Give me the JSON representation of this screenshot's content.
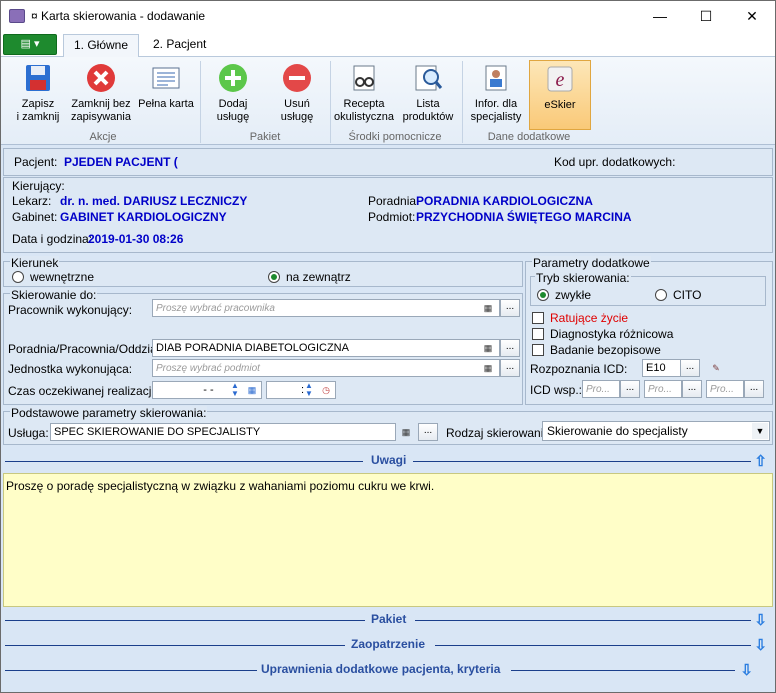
{
  "window": {
    "title": "¤ Karta skierowania - dodawanie",
    "minimize": "—",
    "maximize": "☐",
    "close": "✕"
  },
  "tabs": [
    {
      "label": "1. Główne"
    },
    {
      "label": "2. Pacjent"
    }
  ],
  "ribbon": {
    "save_label_1": "Zapisz",
    "save_label_2": "i zamknij",
    "close_label_1": "Zamknij bez",
    "close_label_2": "zapisywania",
    "fullcard_label": "Pełna karta",
    "group_akcje": "Akcje",
    "add_label_1": "Dodaj",
    "add_label_2": "usługę",
    "remove_label_1": "Usuń",
    "remove_label_2": "usługę",
    "group_pakiet": "Pakiet",
    "recepta_label_1": "Recepta",
    "recepta_label_2": "okulistyczna",
    "produkty_label_1": "Lista",
    "produkty_label_2": "produktów",
    "group_srodki": "Środki pomocnicze",
    "infor_label_1": "Infor. dla",
    "infor_label_2": "specjalisty",
    "eskier_label": "eSkier",
    "group_dane": "Dane dodatkowe"
  },
  "patient": {
    "label": "Pacjent:",
    "value": "PJEDEN PACJENT (",
    "kod_label": "Kod upr. dodatkowych:"
  },
  "kierujacy": {
    "legend": "Kierujący:",
    "lekarz_label": "Lekarz:",
    "lekarz_value": "dr. n. med. DARIUSZ LECZNICZY",
    "gabinet_label": "Gabinet:",
    "gabinet_value": "GABINET KARDIOLOGICZNY",
    "poradnia_label": "Poradnia:",
    "poradnia_value": "PORADNIA KARDIOLOGICZNA",
    "podmiot_label": "Podmiot:",
    "podmiot_value": "PRZYCHODNIA ŚWIĘTEGO MARCINA",
    "data_label": "Data i godzina:",
    "data_value": "2019-01-30 08:26"
  },
  "kierunek": {
    "legend": "Kierunek",
    "opt1": "wewnętrzne",
    "opt2": "na zewnątrz",
    "selected": "na zewnątrz"
  },
  "skierowanie_do": {
    "legend": "Skierowanie do:",
    "pracownik_label": "Pracownik wykonujący:",
    "pracownik_placeholder": "Proszę wybrać pracownika",
    "poradnia_label": "Poradnia/Pracownia/Oddział:",
    "poradnia_value": "DIAB PORADNIA DIABETOLOGICZNA",
    "jednostka_label": "Jednostka wykonująca:",
    "jednostka_placeholder": "Proszę wybrać podmiot",
    "czas_label": "Czas oczekiwanej realizacji:",
    "date_value": "-   -",
    "time_value": ":"
  },
  "parametry": {
    "legend": "Parametry dodatkowe",
    "tryb_legend": "Tryb skierowania:",
    "zwykle": "zwykłe",
    "cito": "CITO",
    "ratujace": "Ratujące życie",
    "diagnostyka": "Diagnostyka różnicowa",
    "badanie": "Badanie bezopisowe",
    "icd_label": "Rozpoznania ICD:",
    "icd_value": "E10",
    "icdwsp_label": "ICD wsp.:",
    "icdwsp_ph": "Pro..."
  },
  "podstawowe": {
    "legend": "Podstawowe parametry skierowania:",
    "usluga_label": "Usługa:",
    "usluga_value": "SPEC SKIEROWANIE DO SPECJALISTY",
    "rodzaj_label": "Rodzaj skierowania:",
    "rodzaj_value": "Skierowanie do specjalisty"
  },
  "sections": {
    "uwagi": "Uwagi",
    "uwagi_text": "Proszę o poradę specjalistyczną w związku z wahaniami poziomu cukru we krwi.",
    "pakiet": "Pakiet",
    "zaopatrzenie": "Zaopatrzenie",
    "uprawnienia": "Uprawnienia dodatkowe pacjenta, kryteria"
  },
  "icons": {
    "ellipsis": "...",
    "dropdown": "▼",
    "arrow_up": "⇧",
    "arrow_down": "⇩"
  }
}
